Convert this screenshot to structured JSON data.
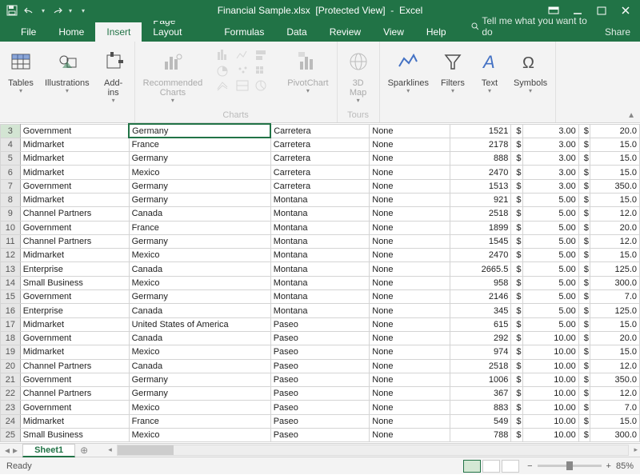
{
  "app": {
    "title_file": "Financial Sample.xlsx",
    "title_mode": "[Protected View]",
    "title_app": "Excel"
  },
  "menubar": {
    "tabs": [
      "File",
      "Home",
      "Insert",
      "Page Layout",
      "Formulas",
      "Data",
      "Review",
      "View",
      "Help"
    ],
    "active": "Insert",
    "tellme": "Tell me what you want to do",
    "share": "Share"
  },
  "ribbon": {
    "groups": [
      {
        "name": "",
        "items": [
          {
            "label": "Tables",
            "icon": "table",
            "disabled": false
          },
          {
            "label": "Illustrations",
            "icon": "illus",
            "disabled": false
          },
          {
            "label": "Add-\nins",
            "icon": "addin",
            "disabled": false
          }
        ]
      },
      {
        "name": "Charts",
        "disabled": true,
        "items": [
          {
            "label": "Recommended\nCharts",
            "icon": "reccharts",
            "disabled": true
          },
          {
            "label": "",
            "icon": "chartgrid",
            "disabled": true
          },
          {
            "label": "PivotChart",
            "icon": "pivot",
            "disabled": true
          }
        ]
      },
      {
        "name": "Tours",
        "disabled": true,
        "items": [
          {
            "label": "3D\nMap",
            "icon": "map",
            "disabled": true
          }
        ]
      },
      {
        "name": "",
        "items": [
          {
            "label": "Sparklines",
            "icon": "spark",
            "disabled": false
          },
          {
            "label": "Filters",
            "icon": "filter",
            "disabled": false
          },
          {
            "label": "Text",
            "icon": "text",
            "disabled": false
          },
          {
            "label": "Symbols",
            "icon": "symbol",
            "disabled": false
          }
        ]
      }
    ]
  },
  "sheet": {
    "first_row": 3,
    "selected_row": 3,
    "rows": [
      {
        "b": "Government",
        "c": "Germany",
        "d": "Carretera",
        "e": "None",
        "f": "1521",
        "h": "3.00",
        "j": "20.0"
      },
      {
        "b": "Midmarket",
        "c": "France",
        "d": "Carretera",
        "e": "None",
        "f": "2178",
        "h": "3.00",
        "j": "15.0"
      },
      {
        "b": "Midmarket",
        "c": "Germany",
        "d": "Carretera",
        "e": "None",
        "f": "888",
        "h": "3.00",
        "j": "15.0"
      },
      {
        "b": "Midmarket",
        "c": "Mexico",
        "d": "Carretera",
        "e": "None",
        "f": "2470",
        "h": "3.00",
        "j": "15.0"
      },
      {
        "b": "Government",
        "c": "Germany",
        "d": "Carretera",
        "e": "None",
        "f": "1513",
        "h": "3.00",
        "j": "350.0"
      },
      {
        "b": "Midmarket",
        "c": "Germany",
        "d": "Montana",
        "e": "None",
        "f": "921",
        "h": "5.00",
        "j": "15.0"
      },
      {
        "b": "Channel Partners",
        "c": "Canada",
        "d": "Montana",
        "e": "None",
        "f": "2518",
        "h": "5.00",
        "j": "12.0"
      },
      {
        "b": "Government",
        "c": "France",
        "d": "Montana",
        "e": "None",
        "f": "1899",
        "h": "5.00",
        "j": "20.0"
      },
      {
        "b": "Channel Partners",
        "c": "Germany",
        "d": "Montana",
        "e": "None",
        "f": "1545",
        "h": "5.00",
        "j": "12.0"
      },
      {
        "b": "Midmarket",
        "c": "Mexico",
        "d": "Montana",
        "e": "None",
        "f": "2470",
        "h": "5.00",
        "j": "15.0"
      },
      {
        "b": "Enterprise",
        "c": "Canada",
        "d": "Montana",
        "e": "None",
        "f": "2665.5",
        "h": "5.00",
        "j": "125.0"
      },
      {
        "b": "Small Business",
        "c": "Mexico",
        "d": "Montana",
        "e": "None",
        "f": "958",
        "h": "5.00",
        "j": "300.0"
      },
      {
        "b": "Government",
        "c": "Germany",
        "d": "Montana",
        "e": "None",
        "f": "2146",
        "h": "5.00",
        "j": "7.0"
      },
      {
        "b": "Enterprise",
        "c": "Canada",
        "d": "Montana",
        "e": "None",
        "f": "345",
        "h": "5.00",
        "j": "125.0"
      },
      {
        "b": "Midmarket",
        "c": "United States of America",
        "d": "Paseo",
        "e": "None",
        "f": "615",
        "h": "5.00",
        "j": "15.0"
      },
      {
        "b": "Government",
        "c": "Canada",
        "d": "Paseo",
        "e": "None",
        "f": "292",
        "h": "10.00",
        "j": "20.0"
      },
      {
        "b": "Midmarket",
        "c": "Mexico",
        "d": "Paseo",
        "e": "None",
        "f": "974",
        "h": "10.00",
        "j": "15.0"
      },
      {
        "b": "Channel Partners",
        "c": "Canada",
        "d": "Paseo",
        "e": "None",
        "f": "2518",
        "h": "10.00",
        "j": "12.0"
      },
      {
        "b": "Government",
        "c": "Germany",
        "d": "Paseo",
        "e": "None",
        "f": "1006",
        "h": "10.00",
        "j": "350.0"
      },
      {
        "b": "Channel Partners",
        "c": "Germany",
        "d": "Paseo",
        "e": "None",
        "f": "367",
        "h": "10.00",
        "j": "12.0"
      },
      {
        "b": "Government",
        "c": "Mexico",
        "d": "Paseo",
        "e": "None",
        "f": "883",
        "h": "10.00",
        "j": "7.0"
      },
      {
        "b": "Midmarket",
        "c": "France",
        "d": "Paseo",
        "e": "None",
        "f": "549",
        "h": "10.00",
        "j": "15.0"
      },
      {
        "b": "Small Business",
        "c": "Mexico",
        "d": "Paseo",
        "e": "None",
        "f": "788",
        "h": "10.00",
        "j": "300.0"
      }
    ],
    "currency": "$",
    "tab_name": "Sheet1"
  },
  "statusbar": {
    "status": "Ready",
    "zoom": "85%"
  }
}
